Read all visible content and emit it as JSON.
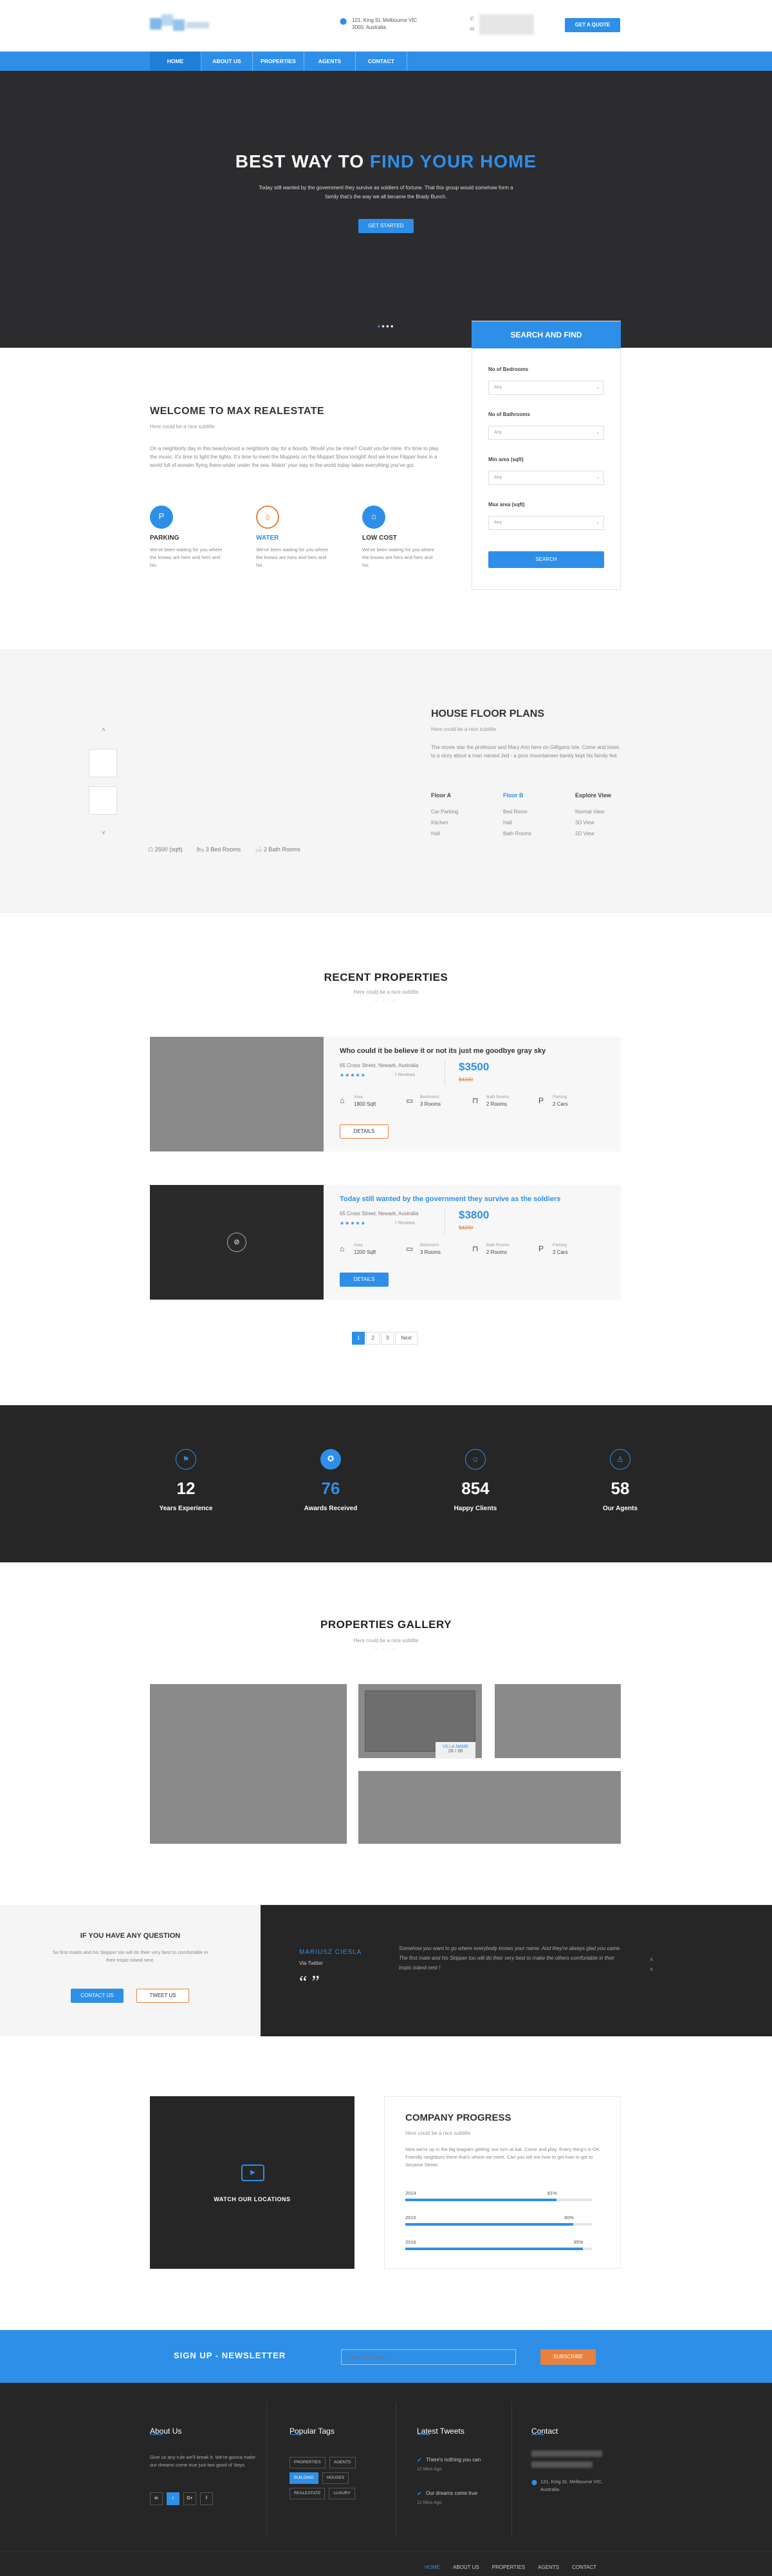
{
  "header": {
    "address": "121, King St, Melbourne VIC 3000, Australia",
    "cta": "GET A QUOTE"
  },
  "nav": {
    "items": [
      "HOME",
      "ABOUT US",
      "PROPERTIES",
      "AGENTS",
      "CONTACT"
    ]
  },
  "hero": {
    "title_a": "BEST WAY TO",
    "title_b": "FIND YOUR HOME",
    "text": "Today still wanted by the government they survive as soldiers of fortune. That this group would somehow form a family that's the way we all became the Brady Bunch.",
    "button": "GET STARTED"
  },
  "search": {
    "title": "SEARCH AND FIND",
    "fields": [
      {
        "label": "No of Bedrooms",
        "value": "Any"
      },
      {
        "label": "No of Bathrooms",
        "value": "Any"
      },
      {
        "label": "Min area (sqft)",
        "value": "Any"
      },
      {
        "label": "Max area (sqft)",
        "value": "Any"
      }
    ],
    "button": "SEARCH"
  },
  "welcome": {
    "title": "WELCOME TO MAX REALESTATE",
    "subtitle": "Here could be a nice subtitle",
    "text": "On a neighborly day in this beautywood a neighborly day for a bounty. Would you be mine? Could you be mine. It's time to play the music. It's time to light the lights. It's time to meet the Muppets on the Muppet Show tonight! And we know Flipper lives in a world full of wonder flying there-under under the sea. Makin' your way in the world today takes everything you've got.",
    "features": [
      {
        "name": "PARKING",
        "text": "We've been waiting for you where the knows are hers and hers and his.",
        "icon": "parking-icon"
      },
      {
        "name": "WATER",
        "text": "We've been waiting for you where the knows are hers and hers and his.",
        "icon": "water-icon"
      },
      {
        "name": "LOW COST",
        "text": "We've been waiting for you where the knows are hers and hers and his.",
        "icon": "house-icon"
      }
    ]
  },
  "floor": {
    "title": "HOUSE FLOOR PLANS",
    "subtitle": "Here could be a nice subtitle",
    "text": "The movie star the professor and Mary Ann here on Gilligans Isle. Come and listen to a story about a man named Jed - a poor mountaineer barely kept his family fed.",
    "columns": [
      {
        "head": "Floor A",
        "items": [
          "Car Parking",
          "Kitchen",
          "Hall"
        ]
      },
      {
        "head": "Floor B",
        "items": [
          "Bed Room",
          "Hall",
          "Bath Rooms"
        ]
      },
      {
        "head": "Explore View",
        "items": [
          "Normal View",
          "3D View",
          "2D View"
        ]
      }
    ],
    "stats": [
      "2500 (sqft)",
      "3 Bed Rooms",
      "2 Bath Rooms"
    ]
  },
  "recent": {
    "title": "RECENT PROPERTIES",
    "subtitle": "Here could be a nice subtitle",
    "items": [
      {
        "title": "Who could it be believe it or not its just me goodbye gray sky",
        "address": "65 Cross Street, Newark, Australia",
        "reviews": "7 Reviews",
        "price": "$3500",
        "old": "$4200",
        "specs": [
          {
            "label": "Area",
            "value": "1800 Sqft"
          },
          {
            "label": "Bedrooms",
            "value": "3 Rooms"
          },
          {
            "label": "Bath Rooms",
            "value": "2 Rooms"
          },
          {
            "label": "Parking",
            "value": "2 Cars"
          }
        ],
        "button": "DETAILS"
      },
      {
        "title": "Today still wanted by the government they survive as the soldiers",
        "address": "65 Cross Street, Newark, Australia",
        "reviews": "7 Reviews",
        "price": "$3800",
        "old": "$4200",
        "specs": [
          {
            "label": "Area",
            "value": "1200 Sqft"
          },
          {
            "label": "Bedrooms",
            "value": "3 Rooms"
          },
          {
            "label": "Bath Rooms",
            "value": "2 Rooms"
          },
          {
            "label": "Parking",
            "value": "2 Cars"
          }
        ],
        "button": "DETAILS"
      }
    ],
    "pages": [
      "1",
      "2",
      "3",
      "Next"
    ]
  },
  "counters": [
    {
      "num": "12",
      "label": "Years Experience"
    },
    {
      "num": "76",
      "label": "Awards Received"
    },
    {
      "num": "854",
      "label": "Happy Clients"
    },
    {
      "num": "58",
      "label": "Our Agents"
    }
  ],
  "gallery": {
    "title": "PROPERTIES GALLERY",
    "subtitle": "Here could be a nice subtitle",
    "badge_a": "VILLA NAME",
    "badge_b": "2B / 3B"
  },
  "question": {
    "title": "IF YOU HAVE ANY QUESTION",
    "text": "So first maids and his Skipper too will do their very best to comfortable in their tropic island nest.",
    "b1": "CONTACT US",
    "b2": "TWEET US"
  },
  "testimonial": {
    "name": "MARIUSZ CIESLA",
    "role": "Via Twitter",
    "text": "Somehow you want to go where everybody knows your name. And they're always glad you came. The first mate and his Skipper too will do their very best to make the others comfortable in their tropic island nest !"
  },
  "locations": {
    "label": "WATCH OUR LOCATIONS"
  },
  "progress": {
    "title": "COMPANY PROGRESS",
    "subtitle": "Here could be a nice subtitle",
    "text": "Now we're up in the big leagues getting' our turn at bat. Come and play. Every thing's A-OK. Friendly neighbors there that's where we meet. Can you tell me how to get how to get to Sesame Street.",
    "bars": [
      {
        "year": "2014",
        "pct": "81%",
        "v": 81
      },
      {
        "year": "2015",
        "pct": "90%",
        "v": 90
      },
      {
        "year": "2016",
        "pct": "95%",
        "v": 95
      }
    ]
  },
  "newsletter": {
    "title": "SIGN UP - NEWSLETTER",
    "placeholder": "Enter your email",
    "button": "SUBSCRIBE"
  },
  "footer": {
    "about_title": "About Us",
    "about_text": "Give us any rule we'll break it. We're gonna make our dreams come true just two good ol' boys.",
    "social": [
      "in",
      "t",
      "G+",
      "f"
    ],
    "tags_title": "Popular Tags",
    "tags": [
      "PROPERTIES",
      "AGENTS",
      "BUILDING",
      "HOUSES",
      "REALESTATE",
      "LUXURY"
    ],
    "tweets_title": "Latest Tweets",
    "tweets": [
      {
        "text": "There's nothing you can",
        "time": "12 Mins Ago"
      },
      {
        "text": "Our dreams come true",
        "time": "12 Mins Ago"
      }
    ],
    "contact_title": "Contact",
    "address": "121, King St, Melbourne VIC, Australia",
    "bottom_nav": [
      "HOME",
      "ABOUT US",
      "PROPERTIES",
      "AGENTS",
      "CONTACT"
    ]
  },
  "colors": {
    "primary": "#2e8fe8",
    "accent": "#e8813c",
    "dark": "#262626"
  }
}
